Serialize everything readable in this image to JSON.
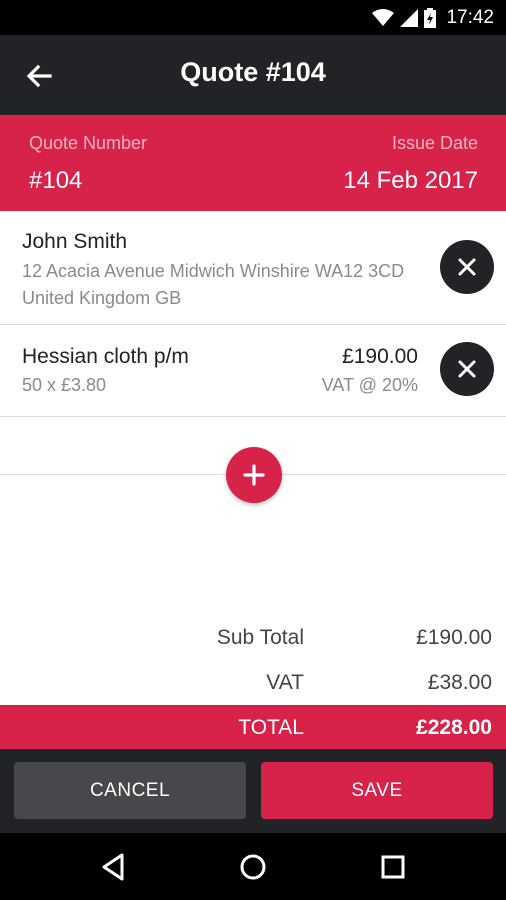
{
  "status_bar": {
    "time": "17:42",
    "icons": [
      "wifi-icon",
      "signal-icon",
      "battery-icon"
    ]
  },
  "app_bar": {
    "title": "Quote #104",
    "back_icon": "arrow-left-icon"
  },
  "quote_info": {
    "number_label": "Quote Number",
    "number_value": "#104",
    "date_label": "Issue Date",
    "date_value": "14 Feb 2017"
  },
  "customer": {
    "name": "John Smith",
    "address": "12 Acacia Avenue Midwich Winshire WA12 3CD United Kingdom GB",
    "remove_icon": "close-icon"
  },
  "line_items": [
    {
      "name": "Hessian cloth p/m",
      "quantity": "50 x £3.80",
      "price": "£190.00",
      "vat": "VAT @ 20%",
      "remove_icon": "close-icon"
    }
  ],
  "add_item_icon": "plus-icon",
  "summary": {
    "subtotal_label": "Sub Total",
    "subtotal_value": "£190.00",
    "vat_label": "VAT",
    "vat_value": "£38.00",
    "total_label": "TOTAL",
    "total_value": "£228.00"
  },
  "actions": {
    "cancel_label": "CANCEL",
    "save_label": "SAVE"
  },
  "nav_bar": {
    "icons": [
      "back-triangle-icon",
      "home-circle-icon",
      "recents-square-icon"
    ]
  },
  "colors": {
    "accent": "#d7234a",
    "dark": "#222326",
    "cancel_button": "#47484b"
  }
}
